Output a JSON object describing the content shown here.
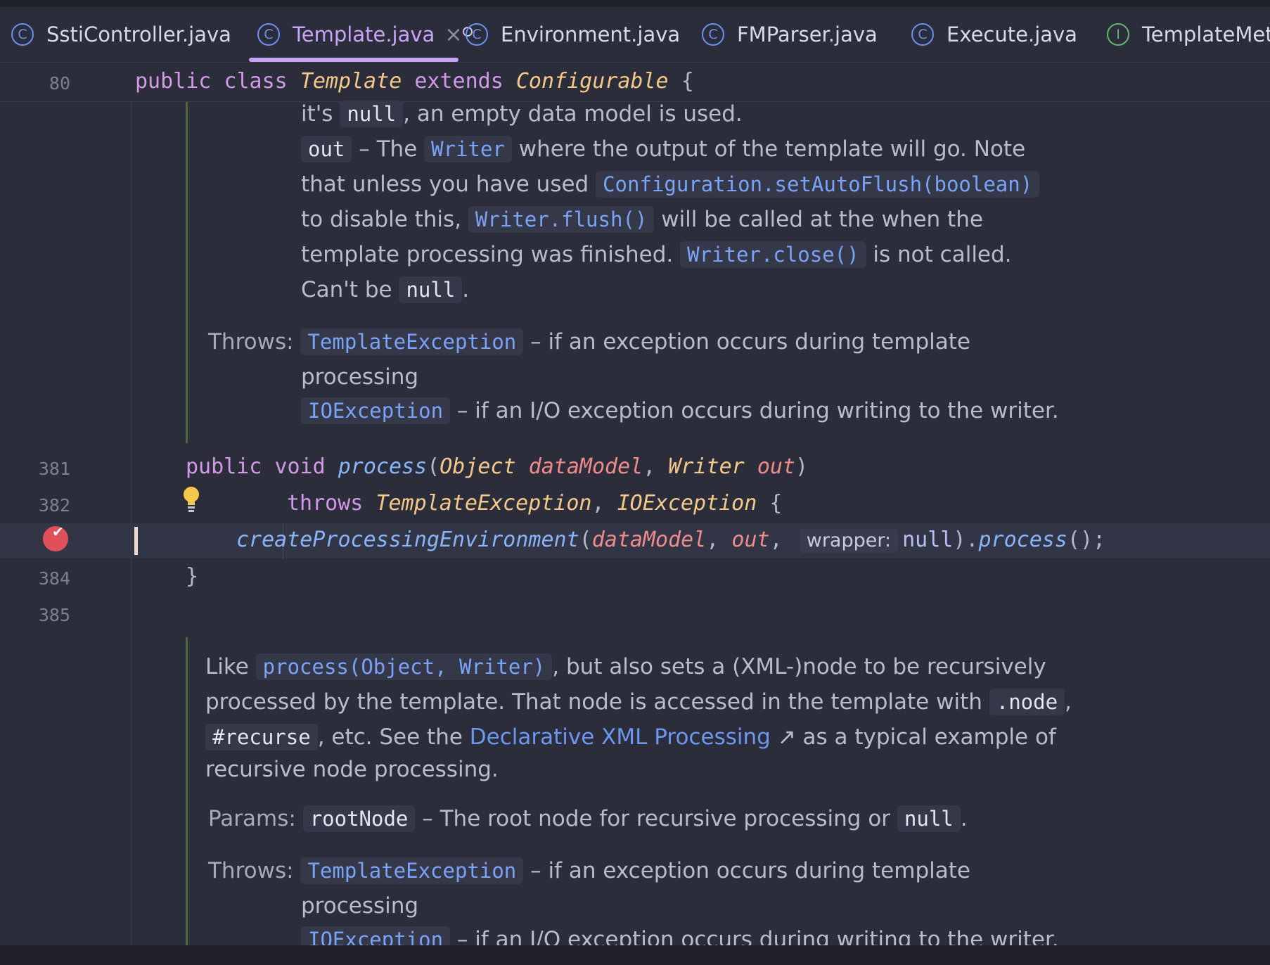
{
  "tabs": [
    {
      "label": "SstiController.java",
      "icon": "class-icon",
      "letter": "C"
    },
    {
      "label": "Template.java",
      "icon": "class-icon",
      "letter": "C",
      "close": "×"
    },
    {
      "label": "Environment.java",
      "icon": "class-icon",
      "letter": "C"
    },
    {
      "label": "FMParser.java",
      "icon": "class-icon",
      "letter": "C"
    },
    {
      "label": "Execute.java",
      "icon": "class-icon",
      "letter": "C"
    },
    {
      "label": "TemplateMeth",
      "icon": "interface-icon",
      "letter": "I"
    }
  ],
  "editor": {
    "sticky": {
      "line": "80",
      "kw1": "public",
      "kw2": "class",
      "name": "Template",
      "kw3": "extends",
      "parent": "Configurable",
      "brace": "{"
    },
    "doc1": {
      "l1_a": "it's",
      "l1_code": "null",
      "l1_b": ", an empty data model is used.",
      "l2_code": "out",
      "l2_a": "– The",
      "l2_link": "Writer",
      "l2_b": "where the output of the template will go. Note",
      "l3_a": "that unless you have used",
      "l3_link": "Configuration.setAutoFlush(boolean)",
      "l4_a": "to disable this,",
      "l4_link": "Writer.flush()",
      "l4_b": "will be called at the when the",
      "l5_a": "template processing was finished.",
      "l5_link": "Writer.close()",
      "l5_b": "is not called.",
      "l6_a": "Can't be",
      "l6_code": "null",
      "l6_b": ".",
      "throws_label": "Throws:",
      "t1_link": "TemplateException",
      "t1_text": "– if an exception occurs during template",
      "t1_cont": "processing",
      "t2_link": "IOException",
      "t2_text": "– if an I/O exception occurs during writing to the writer."
    },
    "code": {
      "l381": "381",
      "l382": "382",
      "l384": "384",
      "l385": "385",
      "public": "public",
      "void": "void",
      "process": "process",
      "paren_open": "(",
      "object_type": "Object",
      "dataModel": "dataModel",
      "comma": ",",
      "writer_type": "Writer",
      "out": "out",
      "paren_close": ")",
      "throws": "throws",
      "te": "TemplateException",
      "ioe": "IOException",
      "brace_open": "{",
      "call": "createProcessingEnvironment",
      "hint": "wrapper:",
      "null": "null",
      "call_tail_a": ").",
      "call_process": "process",
      "call_tail_b": "();",
      "brace_close": "}"
    },
    "doc2": {
      "l1_a": "Like",
      "l1_link": "process(Object, Writer)",
      "l1_b": ", but also sets a (XML-)node to be recursively",
      "l2_a": "processed by the template. That node is accessed in the template with",
      "l2_code": ".node",
      "l2_b": ",",
      "l3_code": "#recurse",
      "l3_a": ", etc. See the",
      "l3_link": "Declarative XML Processing",
      "l3_arrow": "↗",
      "l3_b": "as a typical example of",
      "l4": "recursive node processing.",
      "params_label": "Params:",
      "p_code": "rootNode",
      "p_text": "– The root node for recursive processing or",
      "p_null": "null",
      "p_end": ".",
      "throws_label": "Throws:",
      "t1_link": "TemplateException",
      "t1_text": "– if an exception occurs during template",
      "t1_cont": "processing",
      "t2_link": "IOException",
      "t2_text": "– if an I/O exception occurs during writing to the writer."
    }
  },
  "colors": {
    "accent": "#c7a4f7",
    "background": "#2b2d3a",
    "breakpoint": "#e0505a"
  }
}
